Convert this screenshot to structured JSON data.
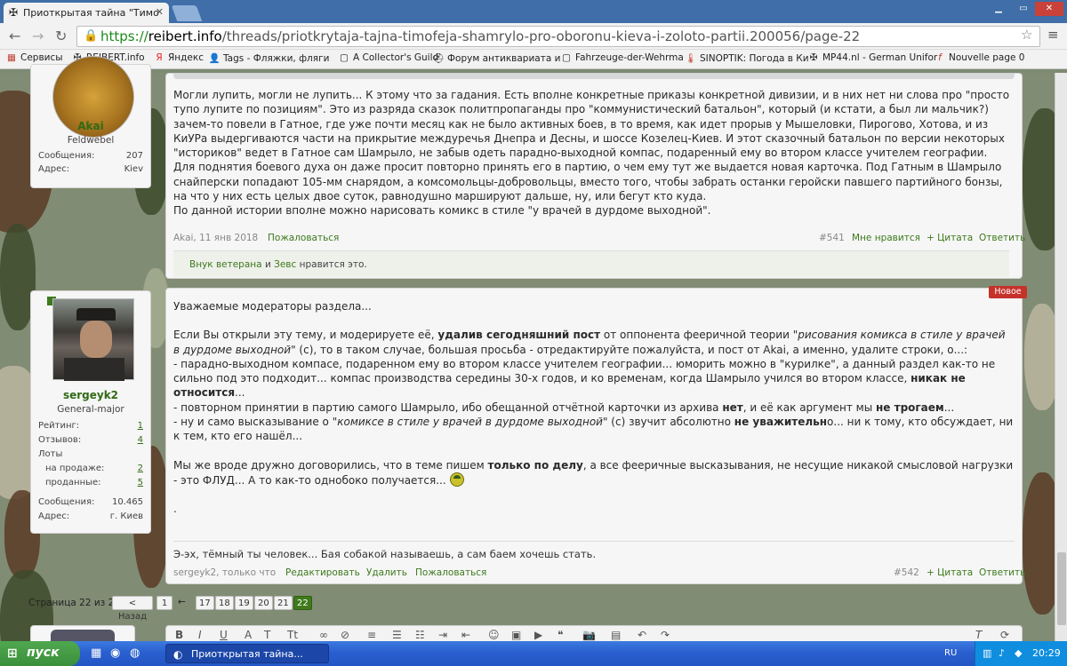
{
  "browser": {
    "tab_title": "Приоткрытая тайна \"Тимо",
    "url_scheme": "https://",
    "url_domain": "reibert.info",
    "url_path": "/threads/priotkrytaja-tajna-timofeja-shamrylo-pro-oboronu-kieva-i-zoloto-partii.200056/page-22",
    "bookmarks": [
      {
        "label": "Сервисы",
        "icon": "apps-icon"
      },
      {
        "label": "REIBERT.info",
        "icon": "cross-icon"
      },
      {
        "label": "Яндекс",
        "icon": "yandex-icon"
      },
      {
        "label": "Tags - Фляжки, фляги",
        "icon": "person-icon"
      },
      {
        "label": "A Collector's Guild",
        "icon": "page-icon"
      },
      {
        "label": "Форум антиквариата и",
        "icon": "helmet-icon"
      },
      {
        "label": "Fahrzeuge-der-Wehrma",
        "icon": "page-icon"
      },
      {
        "label": "SINOPTIK: Погода в Ки",
        "icon": "thermometer-icon"
      },
      {
        "label": "MP44.nl - German Unifor",
        "icon": "cross-icon"
      },
      {
        "label": "Nouvelle page 0",
        "icon": "f-icon"
      }
    ]
  },
  "post1": {
    "user": {
      "name": "Akai",
      "title": "Feldwebel",
      "stats": [
        {
          "label": "Сообщения:",
          "value": "207"
        },
        {
          "label": "Адрес:",
          "value": "Kiev"
        }
      ]
    },
    "paragraphs": [
      "Могли лупить, могли не лупить... К этому что за гадания. Есть вполне конкретные приказы конкретной дивизии, и в них нет ни слова про \"просто тупо лупите по позициям\". Это из разряда сказок политпропаганды про \"коммунистический батальон\", который (и кстати, а был ли мальчик?) зачем-то повели в Гатное, где уже почти месяц как не было активных боев, в то время, как идет прорыв у Мышеловки, Пирогово, Хотова, и из КиУРа выдергиваются части на прикрытие междуречья Днепра и Десны, и шоссе Козелец-Киев. И этот сказочный батальон по версии некоторых \"историков\" ведет в Гатное сам Шамрыло, не забыв одеть парадно-выходной компас, подаренный ему во втором классе учителем географии.",
      "Для поднятия боевого духа он даже просит повторно принять его в партию, о чем ему тут же выдается новая карточка. Под Гатным в Шамрыло снайперски попадают 105-мм снарядом, а комсомольцы-добровольцы, вместо того, чтобы забрать останки геройски павшего партийного бонзы, на что у них есть целых двое суток, равнодушно маршируют дальше, ну, или бегут кто куда.",
      "По данной истории вполне можно нарисовать комикс в стиле \"у врачей в дурдоме выходной\"."
    ],
    "meta": {
      "author_date": "Akai, 11 янв 2018",
      "report": "Пожаловаться",
      "number": "#541",
      "like": "Мне нравится",
      "quote": "+ Цитата",
      "reply": "Ответить"
    },
    "likes": {
      "user1": "Внук ветерана",
      "and": "и",
      "user2": "Зевс",
      "suffix": "нравится это."
    }
  },
  "post2": {
    "badge": "Новое",
    "user": {
      "name": "sergeyk2",
      "title": "General-major",
      "stats": [
        {
          "label": "Рейтинг:",
          "value": "1",
          "link": true
        },
        {
          "label": "Отзывов:",
          "value": "4",
          "link": true
        },
        {
          "label": "Лоты",
          "value": ""
        },
        {
          "label": "на продаже:",
          "value": "2",
          "link": true
        },
        {
          "label": "проданные:",
          "value": "5",
          "link": true
        },
        {
          "label": "Сообщения:",
          "value": "10.465"
        },
        {
          "label": "Адрес:",
          "value": "г. Киев"
        }
      ]
    },
    "greeting": "Уважаемые модераторы раздела...",
    "l1a": "Если Вы открыли эту тему, и модерируете её, ",
    "l1b": "удалив сегодняшний пост",
    "l1c": " от оппонента фееричной теории \"",
    "l1d": "рисования комикса в стиле у врачей в дурдоме выходной",
    "l1e": "\" (с), то в таком случае, большая просьба - отредактируйте пожалуйста, и пост от Akai, а именно, удалите строки, о...:",
    "l2a": "- парадно-выходном компасе, подаренном ему во втором классе учителем географии... юморить можно в \"курилке\", а данный раздел как-то не сильно под это подходит... компас производства середины 30-х годов, и ко временам, когда Шамрыло учился во втором классе, ",
    "l2b": "никак не относится",
    "l2c": "...",
    "l3a": "- повторном принятии в партию самого Шамрыло, ибо обещанной отчётной карточки из архива ",
    "l3b": "нет",
    "l3c": ", и её как аргумент мы ",
    "l3d": "не трогаем",
    "l3e": "...",
    "l4a": "- ну и само высказывание о \"",
    "l4b": "комиксе в стиле у врачей в дурдоме выходной",
    "l4c": "\" (с) звучит абсолютно ",
    "l4d": "не уважительн",
    "l4e": "о... ни к тому, кто обсуждает, ни к тем, кто его нашёл...",
    "l5a": "Мы же вроде дружно договорились, что в теме пишем ",
    "l5b": "только по делу",
    "l5c": ", а все фееричные высказывания, не несущие никакой смысловой нагрузки - это ФЛУД... А то как-то однобоко получается...",
    "dot": ".",
    "signature": "Э-эх, тёмный ты человек... Бая собакой называешь, а сам баем хочешь стать.",
    "meta": {
      "author_date": "sergeyk2, только что",
      "edit": "Редактировать",
      "delete": "Удалить",
      "report": "Пожаловаться",
      "number": "#542",
      "quote": "+ Цитата",
      "reply": "Ответить"
    }
  },
  "pager": {
    "label": "Страница 22 из 22",
    "prev": "< Назад",
    "first": "1",
    "ellipsis": "←",
    "pages": [
      "17",
      "18",
      "19",
      "20",
      "21"
    ],
    "current": "22"
  },
  "taskbar": {
    "start": "пуск",
    "task": "Приоткрытая тайна...",
    "lang": "RU",
    "clock": "20:29"
  },
  "colors": {
    "accent_green": "#316a16",
    "new_badge": "#c4322a",
    "taskbar": "#2356c4"
  }
}
